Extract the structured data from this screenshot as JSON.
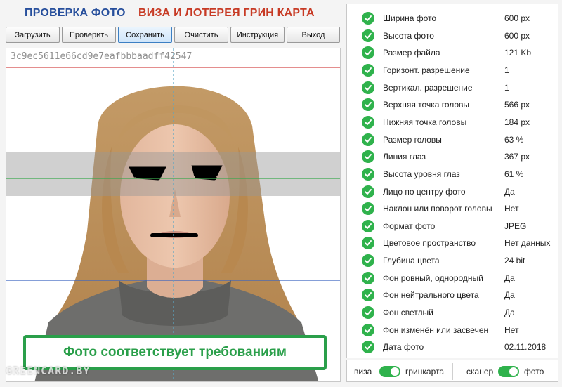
{
  "header": {
    "title_check": "ПРОВЕРКА ФОТО",
    "title_visa": "ВИЗА И ЛОТЕРЕЯ ГРИН КАРТА"
  },
  "toolbar": {
    "buttons": [
      {
        "label": "Загрузить"
      },
      {
        "label": "Проверить"
      },
      {
        "label": "Сохранить"
      },
      {
        "label": "Очистить"
      },
      {
        "label": "Инструкция"
      },
      {
        "label": "Выход"
      }
    ]
  },
  "photo": {
    "hash": "3c9ec5611e66cd9e7eafbbbaadff42547",
    "status_message": "Фото соответствует требованиям",
    "watermark": "GREENCARD.BY"
  },
  "checks": [
    {
      "label": "Ширина фото",
      "value": "600 px"
    },
    {
      "label": "Высота фото",
      "value": "600 px"
    },
    {
      "label": "Размер файла",
      "value": "121 Kb"
    },
    {
      "label": "Горизонт. разрешение",
      "value": "1"
    },
    {
      "label": "Вертикал. разрешение",
      "value": "1"
    },
    {
      "label": "Верхняя точка головы",
      "value": "566 px"
    },
    {
      "label": "Нижняя точка головы",
      "value": "184 px"
    },
    {
      "label": "Размер головы",
      "value": "63 %"
    },
    {
      "label": "Линия глаз",
      "value": "367 px"
    },
    {
      "label": "Высота уровня глаз",
      "value": "61 %"
    },
    {
      "label": "Лицо по центру фото",
      "value": "Да"
    },
    {
      "label": "Наклон или поворот головы",
      "value": "Нет"
    },
    {
      "label": "Формат фото",
      "value": "JPEG"
    },
    {
      "label": "Цветовое пространство",
      "value": "Нет данных"
    },
    {
      "label": "Глубина цвета",
      "value": "24 bit"
    },
    {
      "label": "Фон ровный, однородный",
      "value": "Да"
    },
    {
      "label": "Фон нейтрального цвета",
      "value": "Да"
    },
    {
      "label": "Фон светлый",
      "value": "Да"
    },
    {
      "label": "Фон изменён или засвечен",
      "value": "Нет"
    },
    {
      "label": "Дата фото",
      "value": "02.11.2018"
    }
  ],
  "toggles": {
    "mode_left": "виза",
    "mode_right": "гринкарта",
    "source_left": "сканер",
    "source_right": "фото"
  },
  "colors": {
    "accent_green": "#2fb24c",
    "title_blue": "#274f9c",
    "title_red": "#c73a24"
  }
}
